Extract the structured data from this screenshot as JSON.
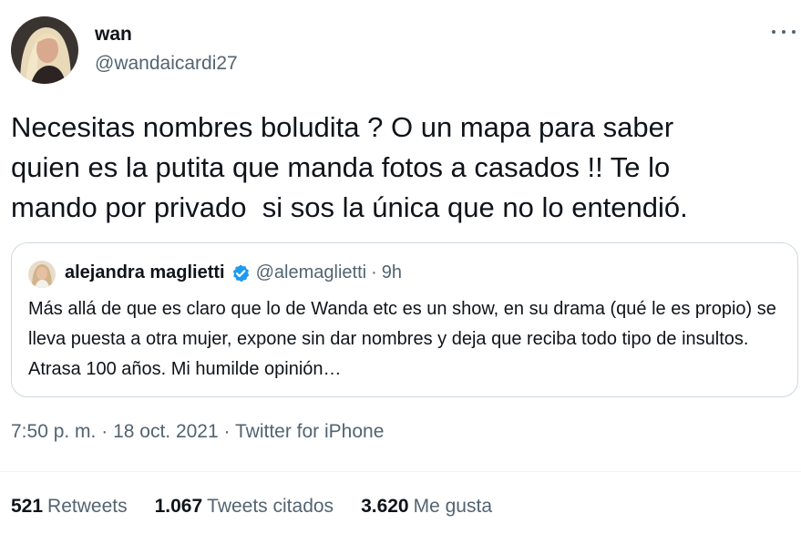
{
  "author": {
    "name": "wan",
    "handle": "@wandaicardi27"
  },
  "tweet": {
    "text": "Necesitas nombres boludita ? O un mapa para saber\nquien es la putita que manda fotos a casados !! Te lo\nmando por privado  si sos la única que no lo entendió."
  },
  "quoted": {
    "name": "alejandra maglietti",
    "handle": "@alemaglietti",
    "separator": "·",
    "time": "9h",
    "text": "Más allá de que es claro que lo de Wanda etc es un show, en su drama (qué le es propio) se lleva puesta a otra mujer, expone sin dar nombres y deja que reciba todo tipo de insultos. Atrasa 100 años. Mi humilde opinión…"
  },
  "meta": {
    "time": "7:50 p. m.",
    "separator": "·",
    "date": "18 oct. 2021",
    "source": "Twitter for iPhone"
  },
  "stats": {
    "retweets_count": "521",
    "retweets_label": "Retweets",
    "quotes_count": "1.067",
    "quotes_label": "Tweets citados",
    "likes_count": "3.620",
    "likes_label": "Me gusta"
  },
  "colors": {
    "text_primary": "#0f1419",
    "text_secondary": "#536471",
    "verified_blue": "#1d9bf0",
    "border": "#cfd9de"
  },
  "icons": {
    "more": "more-horizontal-icon",
    "verified": "verified-badge-icon"
  }
}
